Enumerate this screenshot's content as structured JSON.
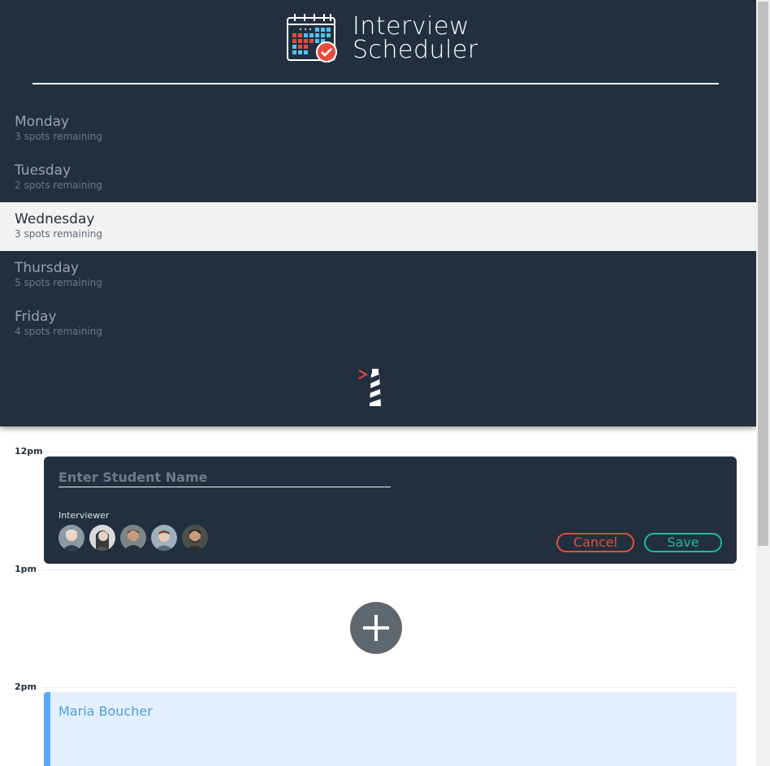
{
  "app": {
    "title_line1": "Interview",
    "title_line2": "Scheduler"
  },
  "days": [
    {
      "name": "Monday",
      "spots": "3 spots remaining"
    },
    {
      "name": "Tuesday",
      "spots": "2 spots remaining"
    },
    {
      "name": "Wednesday",
      "spots": "3 spots remaining",
      "selected": true
    },
    {
      "name": "Thursday",
      "spots": "5 spots remaining"
    },
    {
      "name": "Friday",
      "spots": "4 spots remaining"
    }
  ],
  "schedule": {
    "times": [
      "12pm",
      "1pm",
      "2pm"
    ],
    "form": {
      "student_placeholder": "Enter Student Name",
      "student_value": "",
      "interviewer_label": "Interviewer",
      "interviewers": [
        {
          "id": "interviewer-1"
        },
        {
          "id": "interviewer-2"
        },
        {
          "id": "interviewer-3"
        },
        {
          "id": "interviewer-4"
        },
        {
          "id": "interviewer-5"
        }
      ],
      "cancel_label": "Cancel",
      "save_label": "Save"
    },
    "add_icon": "plus-icon",
    "appointment": {
      "student": "Maria Boucher"
    }
  },
  "colors": {
    "sidebar_bg": "#222f3e",
    "selected_day_bg": "#f2f2f2",
    "cancel": "#e74c3c",
    "save": "#1abc9c",
    "appointment_accent": "#57a8ff",
    "appointment_bg": "#e3effc"
  }
}
